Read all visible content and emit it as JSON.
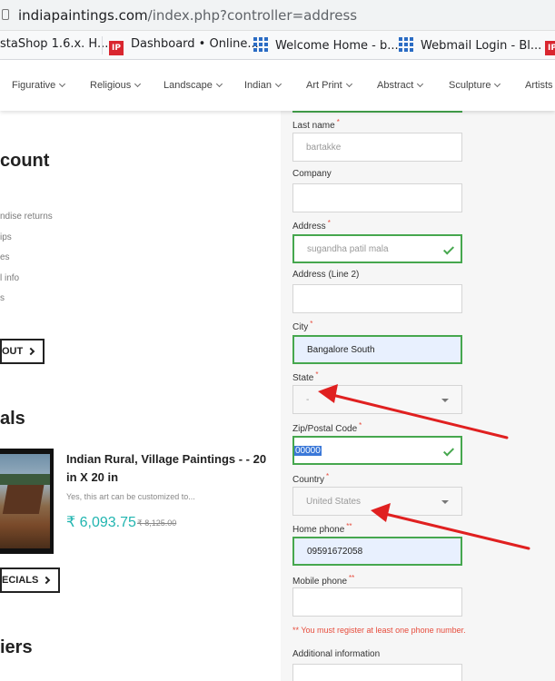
{
  "browser": {
    "url_host": "indiapaintings.com",
    "url_path": "/index.php?controller=address",
    "bookmarks": [
      {
        "label": "estaShop 1.6.x. H...",
        "icon": "none"
      },
      {
        "label": "Dashboard • Online...",
        "icon": "ip-logo-icon"
      },
      {
        "label": "Welcome Home - b...",
        "icon": "grid-icon"
      },
      {
        "label": "Webmail Login - Bl...",
        "icon": "grid-icon"
      }
    ]
  },
  "nav": {
    "items": [
      "Figurative",
      "Religious",
      "Landscape",
      "Indian",
      "Art Print",
      "Abstract",
      "Sculpture",
      "Artists"
    ]
  },
  "account": {
    "heading": "count",
    "links": [
      "ndise returns",
      "ips",
      "es",
      "l info",
      "s"
    ],
    "button": "OUT"
  },
  "specials": {
    "heading": "als",
    "product_title": "Indian Rural, Village Paintings - - 20 in X 20 in",
    "product_desc": "Yes, this art can be customized to...",
    "price": "₹ 6,093.75",
    "old_price": "₹ 8,125.00",
    "button": "ECIALS"
  },
  "suppliers": {
    "heading": "iers"
  },
  "form": {
    "required_mark": "*",
    "phone_required_mark": "**",
    "last_name": {
      "label": "Last name",
      "value": "bartakke"
    },
    "company": {
      "label": "Company",
      "value": ""
    },
    "address": {
      "label": "Address",
      "value": "sugandha patil mala"
    },
    "address2": {
      "label": "Address (Line 2)",
      "value": ""
    },
    "city": {
      "label": "City",
      "value": "Bangalore South"
    },
    "state": {
      "label": "State",
      "value": "-"
    },
    "zip": {
      "label": "Zip/Postal Code",
      "value": "00000"
    },
    "country": {
      "label": "Country",
      "value": "United States"
    },
    "home_phone": {
      "label": "Home phone",
      "value": "09591672058"
    },
    "mobile_phone": {
      "label": "Mobile phone",
      "value": ""
    },
    "phone_note": "** You must register at least one phone number.",
    "additional": {
      "label": "Additional information"
    }
  },
  "colors": {
    "valid_green": "#46a74e",
    "required_red": "#e74c3c",
    "price_teal": "#21b5b0",
    "arrow_red": "#e02020"
  }
}
